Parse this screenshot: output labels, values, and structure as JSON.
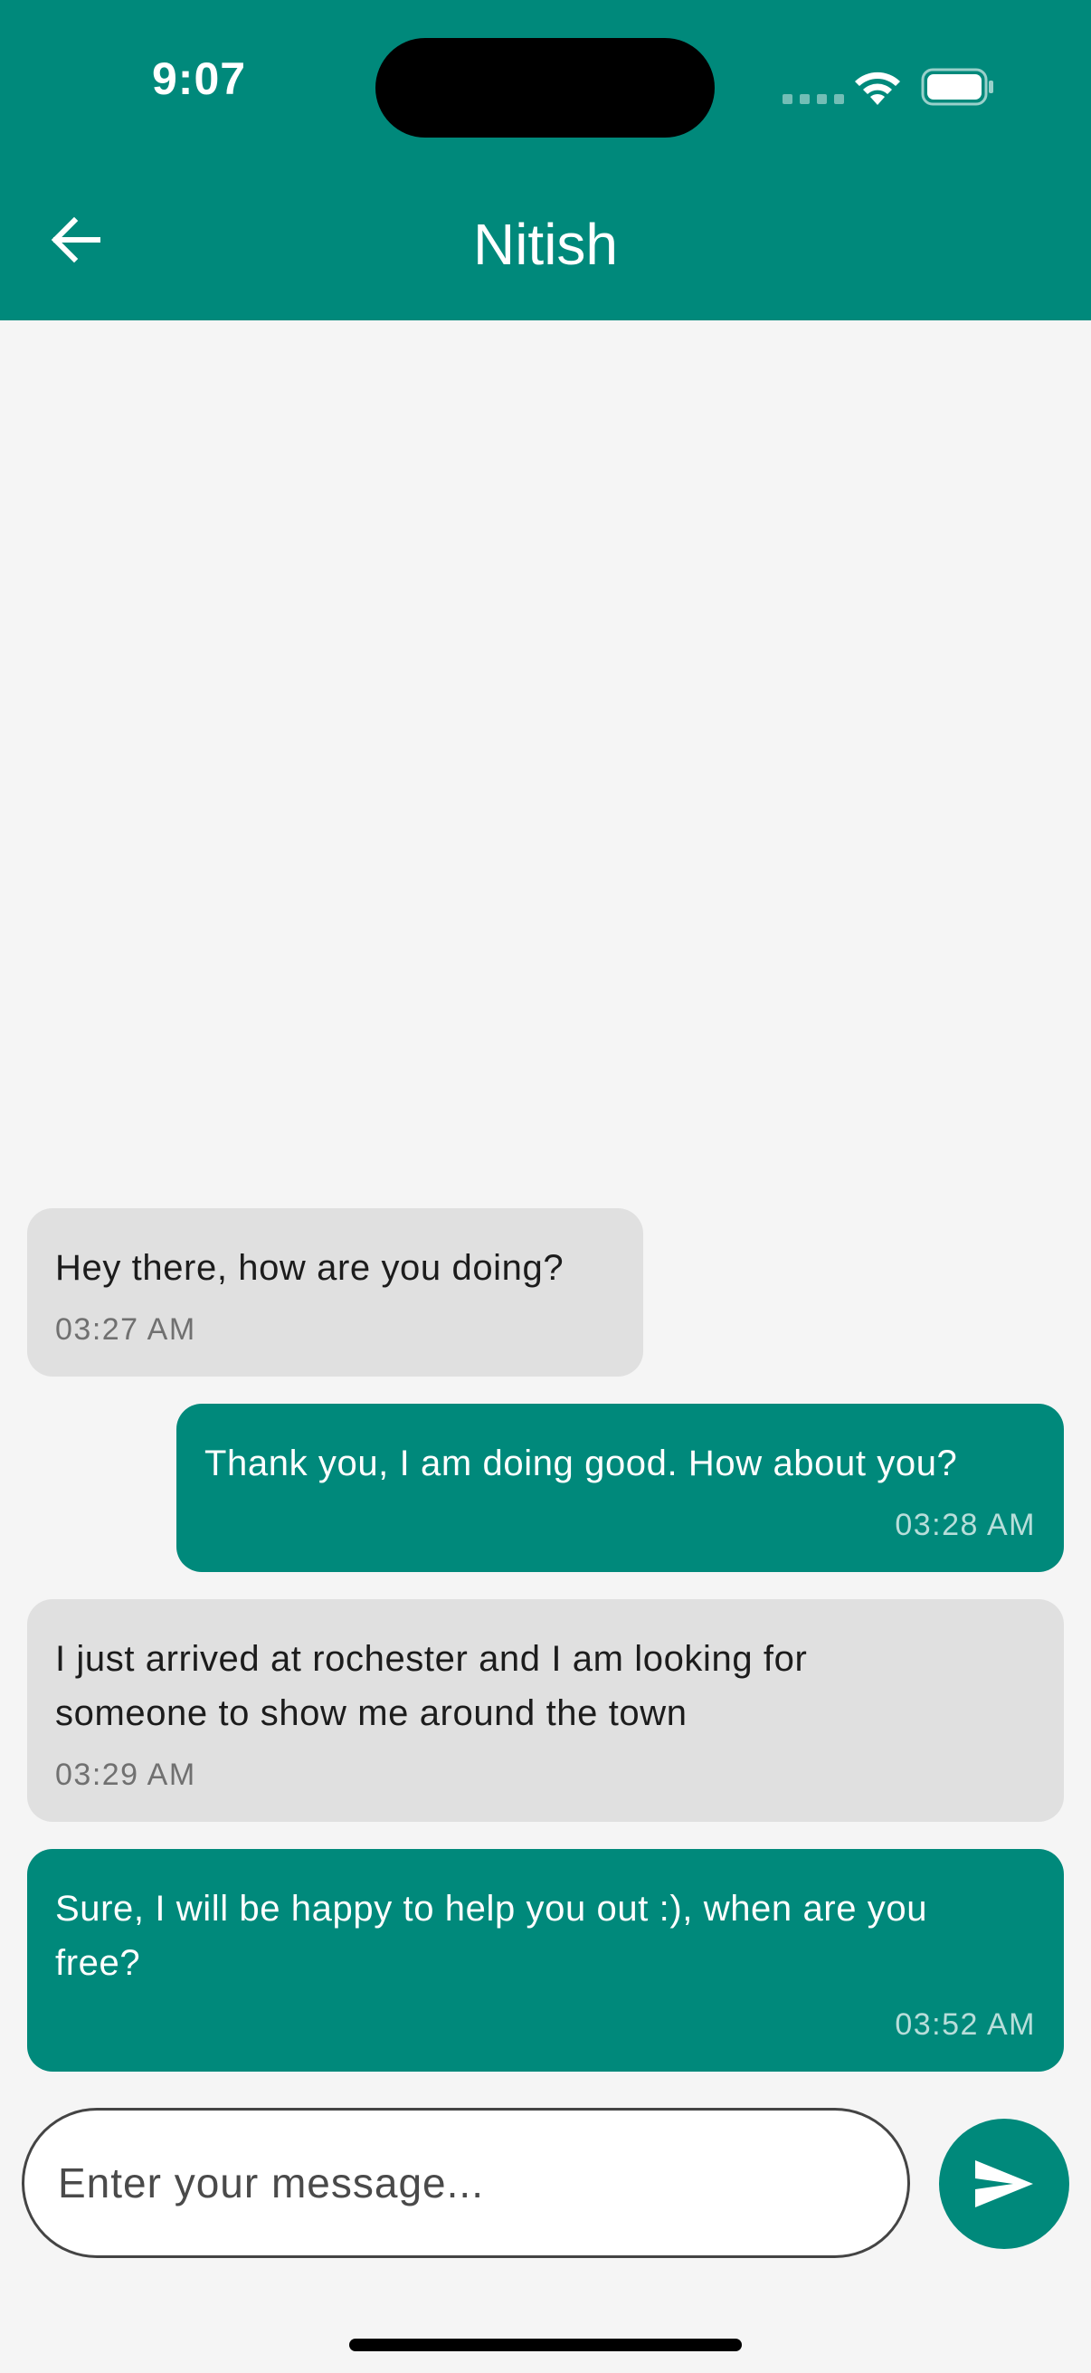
{
  "status_bar": {
    "time": "9:07"
  },
  "header": {
    "title": "Nitish",
    "back_icon": "arrow-left-icon"
  },
  "messages": [
    {
      "direction": "received",
      "text_lines": [
        "Hey there, how are you doing?"
      ],
      "time": "03:27 AM"
    },
    {
      "direction": "sent",
      "text_lines": [
        "Thank you, I am doing good. How about you?"
      ],
      "time": "03:28 AM"
    },
    {
      "direction": "received",
      "text_lines": [
        "I just arrived at rochester and I am looking for",
        "someone to show me around the town"
      ],
      "time": "03:29 AM"
    },
    {
      "direction": "sent",
      "text_lines": [
        "Sure, I will be happy to help you out :), when are you",
        "free?"
      ],
      "time": "03:52 AM"
    }
  ],
  "composer": {
    "placeholder": "Enter your message...",
    "value": "",
    "send_icon": "send-icon"
  },
  "colors": {
    "primary": "#00897b",
    "received_bubble": "#e0e0e0",
    "background": "#f5f5f5"
  }
}
